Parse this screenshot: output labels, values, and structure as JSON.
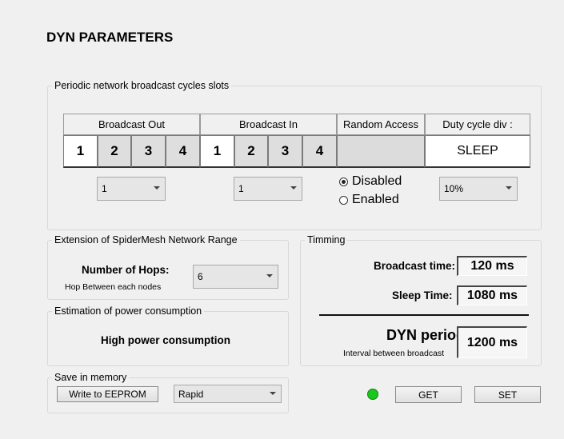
{
  "title": "DYN PARAMETERS",
  "slots": {
    "legend": "Periodic network broadcast cycles slots",
    "headers": {
      "broadcast_out": "Broadcast Out",
      "broadcast_in": "Broadcast In",
      "random_access": "Random Access",
      "duty_cycle": "Duty cycle div :"
    },
    "out_slots": [
      "1",
      "2",
      "3",
      "4"
    ],
    "in_slots": [
      "1",
      "2",
      "3",
      "4"
    ],
    "duty_value": "SLEEP",
    "out_select": "1",
    "in_select": "1",
    "random_access_options": {
      "disabled": "Disabled",
      "enabled": "Enabled",
      "selected": "Disabled"
    },
    "duty_select": "10%"
  },
  "extension": {
    "legend": "Extension of SpiderMesh Network Range",
    "hops_label": "Number of Hops:",
    "hops_sub": "Hop Between each nodes",
    "hops_value": "6"
  },
  "estimation": {
    "legend": "Estimation of power consumption",
    "value": "High power consumption"
  },
  "memory": {
    "legend": "Save in memory",
    "write_button": "Write to EEPROM",
    "mode_value": "Rapid"
  },
  "timing": {
    "legend": "Timming",
    "broadcast_label": "Broadcast time:",
    "broadcast_value": "120 ms",
    "sleep_label": "Sleep Time:",
    "sleep_value": "1080 ms",
    "period_label": "DYN period:",
    "period_sub": "Interval between broadcast",
    "period_value": "1200 ms"
  },
  "actions": {
    "get": "GET",
    "set": "SET",
    "status_color": "#18c81a"
  }
}
